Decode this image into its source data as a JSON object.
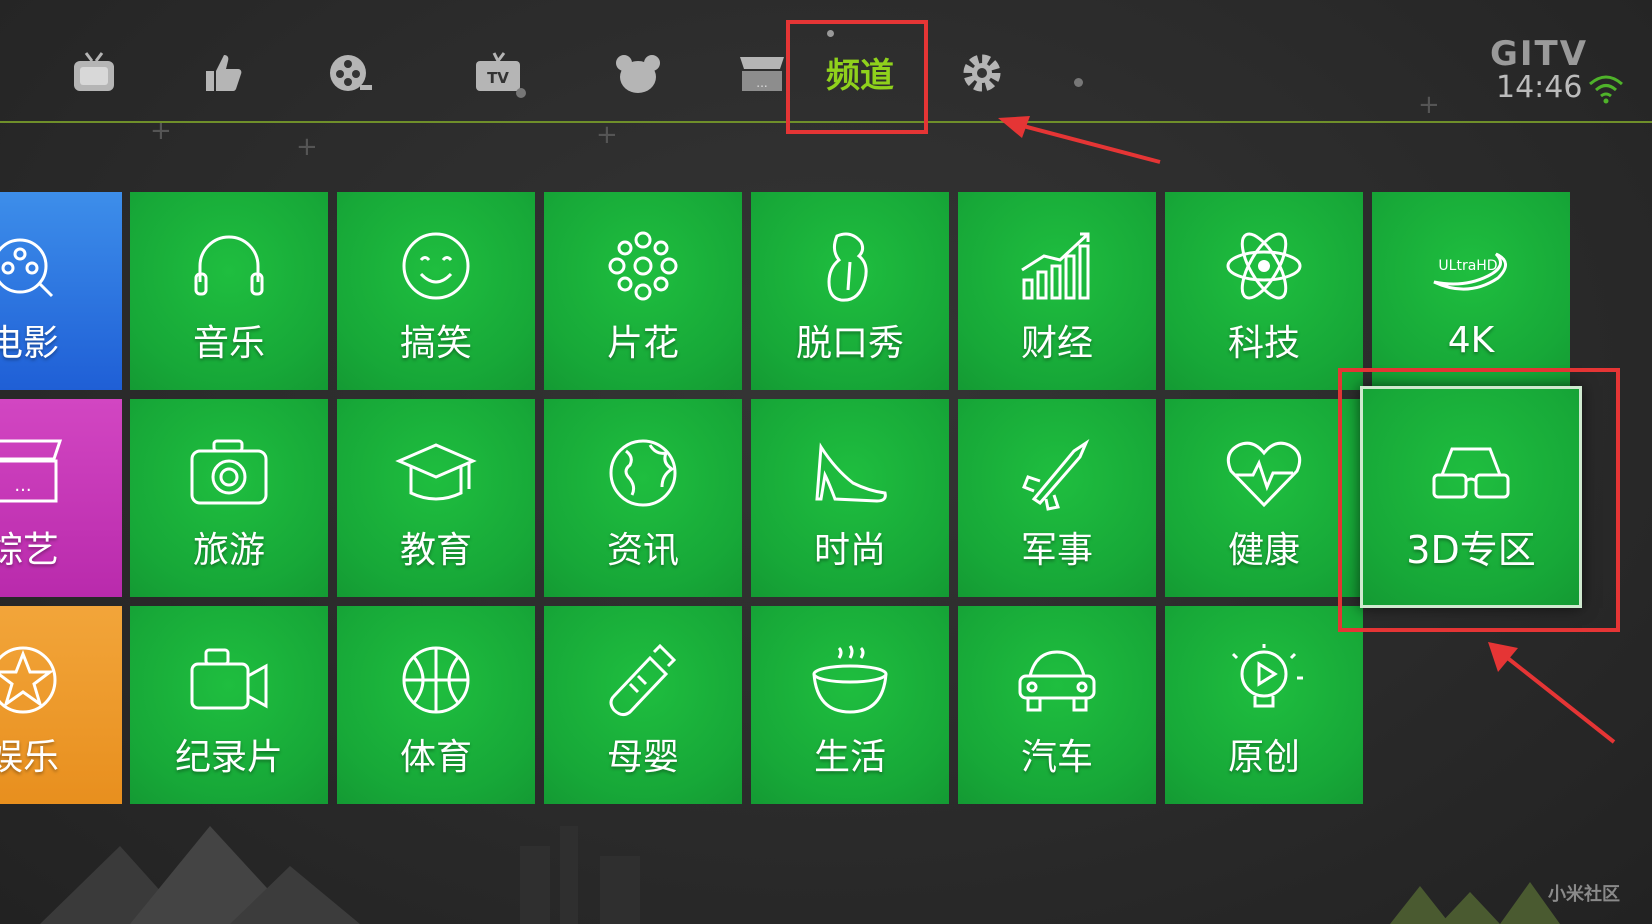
{
  "nav": {
    "items": [
      {
        "name": "live-tv-icon"
      },
      {
        "name": "recommend-thumb-icon"
      },
      {
        "name": "film-reel-icon"
      },
      {
        "name": "tv-icon",
        "tv_text": "TV"
      },
      {
        "name": "kids-bear-icon"
      },
      {
        "name": "variety-stage-icon"
      },
      {
        "name": "channel-tab",
        "label": "频道"
      },
      {
        "name": "settings-gear-icon"
      }
    ],
    "active_color": "#8fd11c"
  },
  "status": {
    "logo": "GITV",
    "time": "14:46"
  },
  "tiles": {
    "row1": [
      {
        "label": "电影",
        "icon": "film-reel-icon"
      },
      {
        "label": "音乐",
        "icon": "headphones-icon"
      },
      {
        "label": "搞笑",
        "icon": "smiley-icon"
      },
      {
        "label": "片花",
        "icon": "flower-icon"
      },
      {
        "label": "脱口秀",
        "icon": "tongue-icon"
      },
      {
        "label": "财经",
        "icon": "bar-trend-icon"
      },
      {
        "label": "科技",
        "icon": "atom-icon"
      },
      {
        "label": "4K",
        "icon": "ultrahd-icon",
        "badge": "ULtraHD"
      }
    ],
    "row2": [
      {
        "label": "综艺",
        "icon": "stage-icon"
      },
      {
        "label": "旅游",
        "icon": "camera-icon"
      },
      {
        "label": "教育",
        "icon": "graduation-cap-icon"
      },
      {
        "label": "资讯",
        "icon": "globe-icon"
      },
      {
        "label": "时尚",
        "icon": "high-heel-icon"
      },
      {
        "label": "军事",
        "icon": "missile-icon"
      },
      {
        "label": "健康",
        "icon": "heart-pulse-icon"
      },
      {
        "label": "3D专区",
        "icon": "3d-glasses-icon"
      }
    ],
    "row3": [
      {
        "label": "娱乐",
        "icon": "star-icon"
      },
      {
        "label": "纪录片",
        "icon": "video-camera-icon"
      },
      {
        "label": "体育",
        "icon": "basketball-icon"
      },
      {
        "label": "母婴",
        "icon": "baby-bottle-icon"
      },
      {
        "label": "生活",
        "icon": "bowl-icon"
      },
      {
        "label": "汽车",
        "icon": "car-icon"
      },
      {
        "label": "原创",
        "icon": "lightbulb-play-icon"
      }
    ]
  },
  "colors": {
    "tile_green": "#17a838",
    "highlight_red": "#e53535"
  },
  "watermark": "小米社区"
}
